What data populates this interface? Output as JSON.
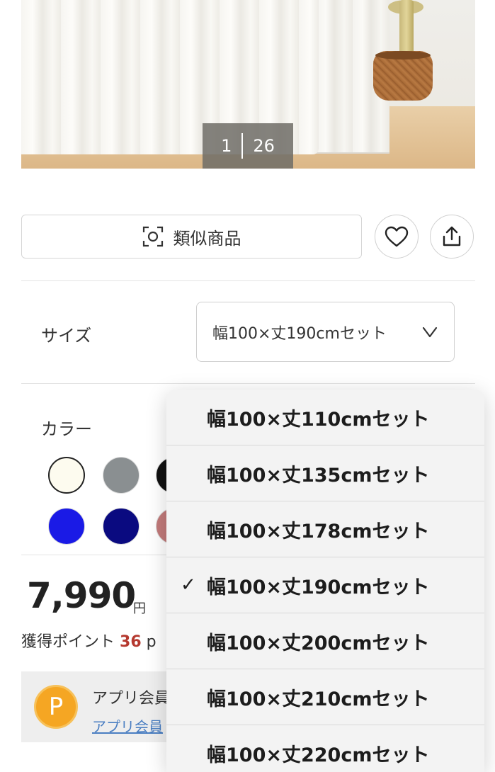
{
  "gallery": {
    "current": "1",
    "total": "26"
  },
  "actions": {
    "similar_label": "類似商品",
    "icons": {
      "similar": "scan-icon",
      "favorite": "heart-icon",
      "share": "share-icon"
    }
  },
  "size": {
    "label": "サイズ",
    "selected": "幅100×丈190cmセット"
  },
  "color": {
    "label": "カラー",
    "swatches": [
      "#fdfbef",
      "#8a8f91",
      "#111111",
      "#1a1ae6",
      "#0a0a80",
      "#c27a7a"
    ]
  },
  "price": {
    "amount": "7,990",
    "unit": "円"
  },
  "points": {
    "label": "獲得ポイント",
    "value": "36",
    "unit": "p"
  },
  "app": {
    "badge": "P",
    "title": "アプリ会員",
    "link": "アプリ会員"
  },
  "size_dropdown": {
    "options": [
      {
        "label": "幅100×丈110cmセット",
        "checked": false
      },
      {
        "label": "幅100×丈135cmセット",
        "checked": false
      },
      {
        "label": "幅100×丈178cmセット",
        "checked": false
      },
      {
        "label": "幅100×丈190cmセット",
        "checked": true
      },
      {
        "label": "幅100×丈200cmセット",
        "checked": false
      },
      {
        "label": "幅100×丈210cmセット",
        "checked": false
      },
      {
        "label": "幅100×丈220cmセット",
        "checked": false
      }
    ],
    "check_mark": "✓"
  }
}
